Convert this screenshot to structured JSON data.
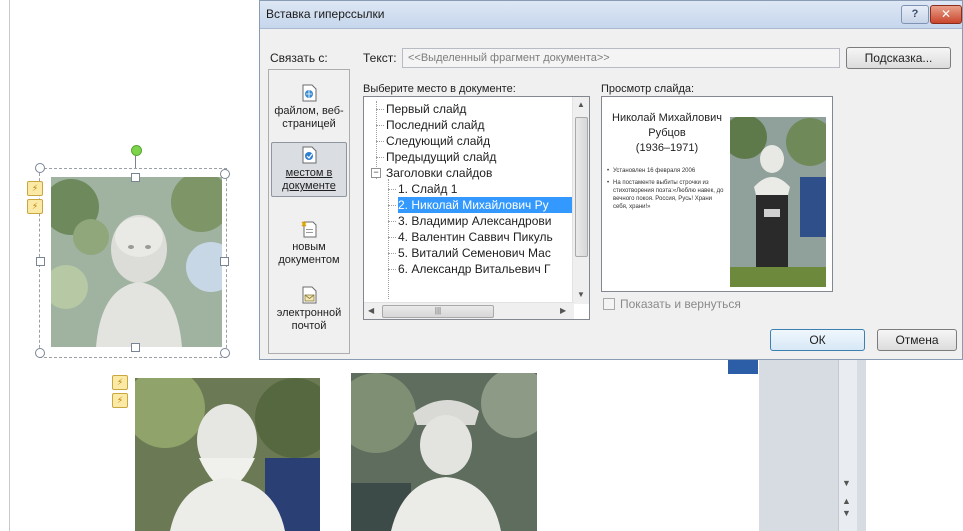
{
  "dialog": {
    "title": "Вставка гиперссылки",
    "help_symbol": "?",
    "close_symbol": "✕",
    "link_to_label": "Связать с:",
    "text_label": "Текст:",
    "text_value": "<<Выделенный фрагмент документа>>",
    "hint_button": "Подсказка...",
    "link_options": [
      {
        "label": "файлом, веб-страницей",
        "icon": "web-file-icon"
      },
      {
        "label": "местом в документе",
        "icon": "place-in-document-icon",
        "active": true
      },
      {
        "label": "новым документом",
        "icon": "new-document-icon"
      },
      {
        "label": "электронной почтой",
        "icon": "email-icon"
      }
    ],
    "place_label": "Выберите место в документе:",
    "tree": {
      "items": [
        "Первый слайд",
        "Последний слайд",
        "Следующий слайд",
        "Предыдущий слайд",
        "Заголовки слайдов",
        "1. Слайд 1",
        "2. Николай Михайлович Ру",
        "3. Владимир Александрови",
        "4. Валентин Саввич Пикуль",
        "5. Виталий Семенович Мас",
        "6. Александр Витальевич Г"
      ],
      "expander_symbol": "−",
      "selected_index": 6
    },
    "preview_label": "Просмотр слайда:",
    "preview": {
      "title_lines": [
        "Николай Михайлович",
        "Рубцов",
        "(1936–1971)"
      ],
      "bullets": [
        "Установлен 16 февраля 2006",
        "На постаменте выбиты строчки из стихотворения поэта:«Люблю навек, до вечного покоя. Россия, Русь! Храни себя, храни!»"
      ]
    },
    "show_and_return_label": "Показать и вернуться",
    "show_and_return_checked": false,
    "ok_button": "ОК",
    "cancel_button": "Отмена"
  },
  "colors": {
    "selection": "#3399ff",
    "titlebar": "#c6d6ec",
    "close": "#c9462c"
  }
}
